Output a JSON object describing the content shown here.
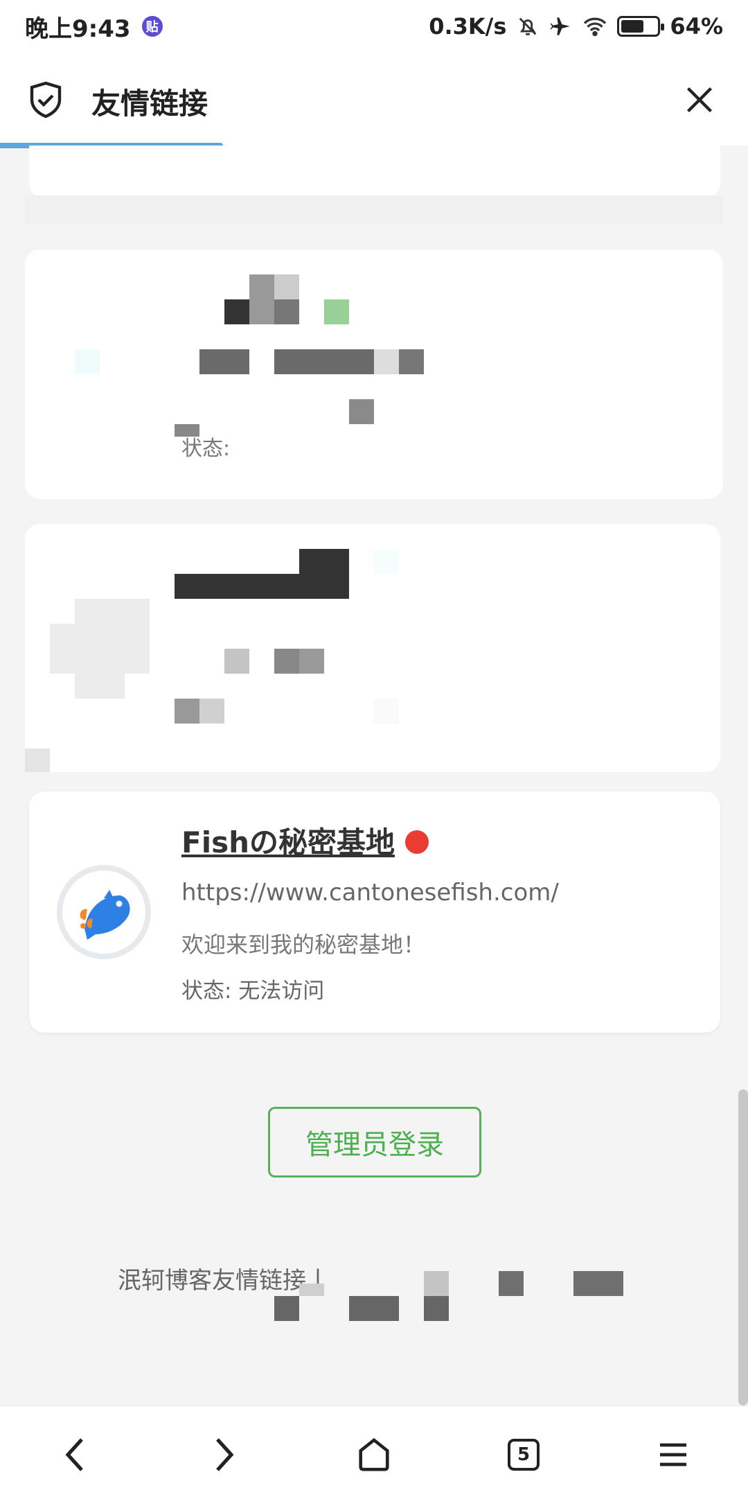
{
  "status_bar": {
    "time": "晚上9:43",
    "app_badge": "贴",
    "speed": "0.3K/s",
    "battery": "64%"
  },
  "header": {
    "title": "友情链接"
  },
  "partial_card": {
    "status_prefix": "状态: "
  },
  "featured_link": {
    "name": "Fishの秘密基地",
    "url": "https://www.cantonesefish.com/",
    "description": "欢迎来到我的秘密基地！",
    "status": "状态: 无法访问",
    "status_color": "#ea3c33"
  },
  "admin_login": {
    "label": "管理员登录"
  },
  "footer": {
    "text": "泯轲博客友情链接丨"
  },
  "bottom_nav": {
    "tabs_count": "5"
  },
  "colors": {
    "accent_green": "#4caf50",
    "progress_blue": "#5aa9d8"
  }
}
